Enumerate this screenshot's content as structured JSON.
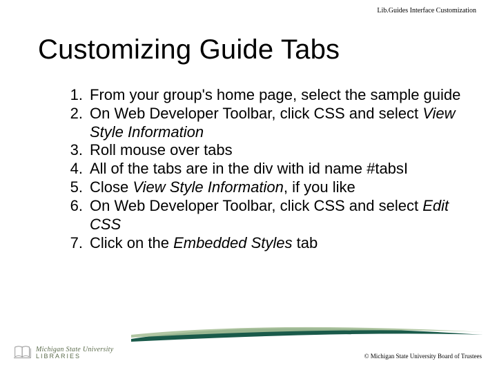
{
  "header": "Lib.Guides Interface Customization",
  "title": "Customizing Guide Tabs",
  "steps": [
    {
      "segments": [
        {
          "text": "From your group's home page, select the sample guide"
        }
      ]
    },
    {
      "segments": [
        {
          "text": "On Web Developer Toolbar, click CSS and select "
        },
        {
          "text": "View Style Information",
          "italic": true
        }
      ]
    },
    {
      "segments": [
        {
          "text": "Roll mouse over tabs"
        }
      ]
    },
    {
      "segments": [
        {
          "text": "All of the tabs are in the div with id name #tabsI"
        }
      ]
    },
    {
      "segments": [
        {
          "text": "Close "
        },
        {
          "text": "View Style Information",
          "italic": true
        },
        {
          "text": ", if you like"
        }
      ]
    },
    {
      "segments": [
        {
          "text": "On Web Developer Toolbar, click CSS and select "
        },
        {
          "text": "Edit CSS",
          "italic": true
        }
      ]
    },
    {
      "segments": [
        {
          "text": "Click on the "
        },
        {
          "text": "Embedded Styles",
          "italic": true
        },
        {
          "text": " tab"
        }
      ]
    }
  ],
  "logo": {
    "university": "Michigan State University",
    "libraries": "LIBRARIES"
  },
  "copyright": "© Michigan State University Board of Trustees"
}
